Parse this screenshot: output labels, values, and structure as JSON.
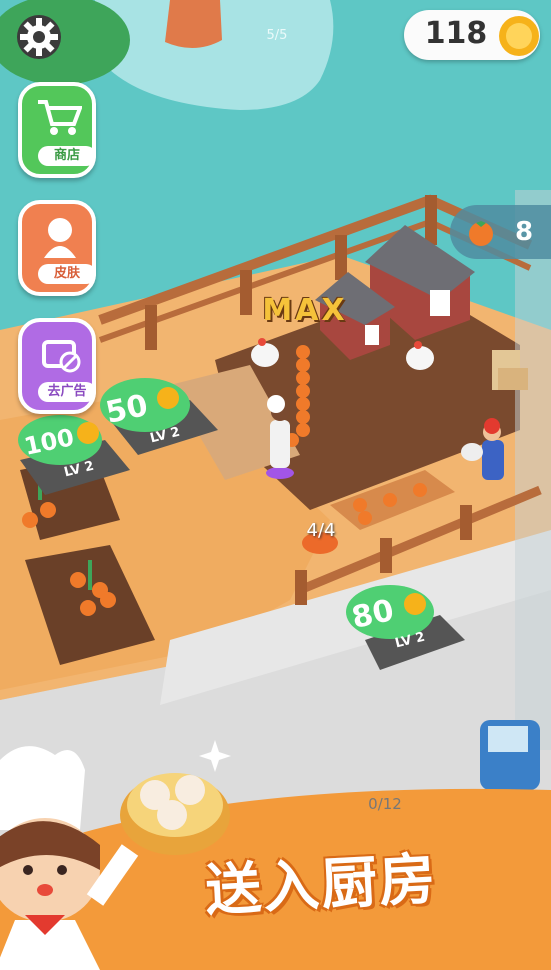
{
  "hud": {
    "coins": "118",
    "stage_counter": "5/5",
    "tomato_count": "8"
  },
  "sidebar": {
    "shop_label": "商店",
    "skin_label": "皮肤",
    "ad_label": "去广告"
  },
  "world": {
    "max_label": "MAX",
    "basket_counter": "4/4",
    "bottom_counter": "0/12"
  },
  "badges": [
    {
      "price": "100",
      "level": "LV 2"
    },
    {
      "price": "50",
      "level": "LV 2"
    },
    {
      "price": "80",
      "level": "LV 2"
    }
  ],
  "banner": {
    "text": "送入厨房"
  },
  "colors": {
    "water": "#5ec7c5",
    "sand": "#f2b570",
    "fence": "#b86c3c",
    "soil": "#7a4a2e",
    "road": "#dcdcdc",
    "orange_bg": "#f3a441",
    "shop_green": "#53c75a",
    "skin_orange": "#f08050",
    "ad_purple": "#b06be4",
    "price_green": "#4fcf73"
  }
}
